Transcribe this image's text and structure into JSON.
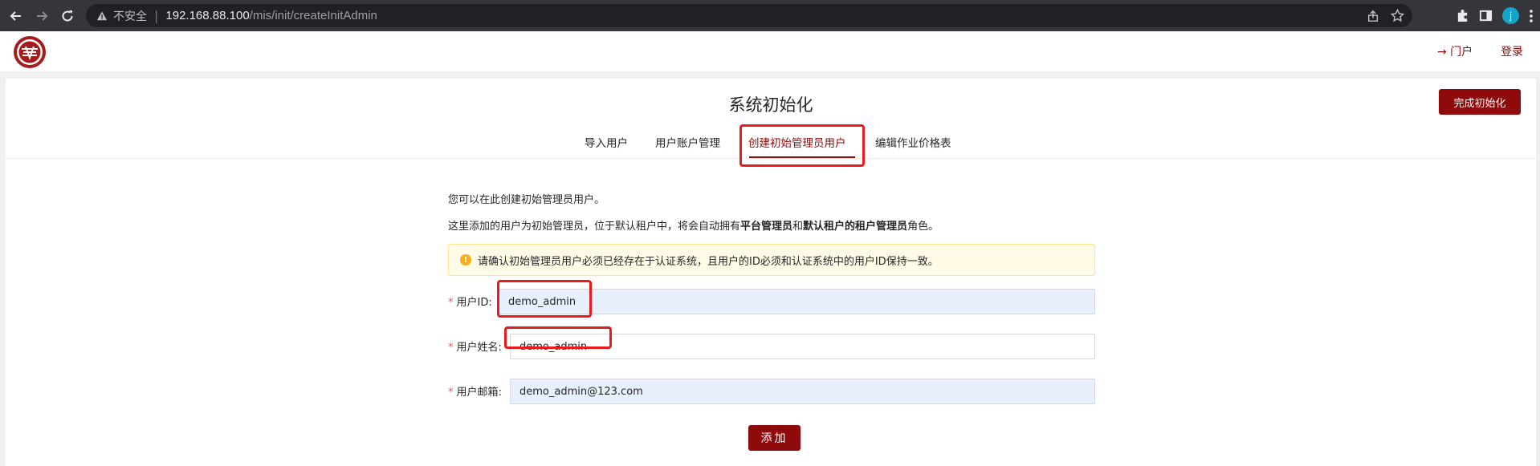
{
  "browser": {
    "insecure_label": "不安全",
    "url_host": "192.168.88.100",
    "url_path": "/mis/init/createInitAdmin",
    "profile_initial": "j"
  },
  "header": {
    "portal_link": "→ 门户",
    "login_link": "登录"
  },
  "page": {
    "title": "系统初始化",
    "finish_button": "完成初始化",
    "tabs": [
      {
        "label": "导入用户",
        "active": false
      },
      {
        "label": "用户账户管理",
        "active": false
      },
      {
        "label": "创建初始管理员用户",
        "active": true
      },
      {
        "label": "编辑作业价格表",
        "active": false
      }
    ],
    "intro": "您可以在此创建初始管理员用户。",
    "desc_prefix": "这里添加的用户为初始管理员，位于默认租户中，将会自动拥有",
    "desc_role1": "平台管理员",
    "desc_and": "和",
    "desc_role2": "默认租户的租户管理员",
    "desc_suffix": "角色。",
    "alert_text": "请确认初始管理员用户必须已经存在于认证系统，且用户的ID必须和认证系统中的用户ID保持一致。",
    "form": {
      "required_mark": "*",
      "user_id_label": "用户ID:",
      "user_id_value": "demo_admin",
      "user_name_label": "用户姓名:",
      "user_name_value": "demo_admin",
      "email_label": "用户邮箱:",
      "email_value": "demo_admin@123.com"
    },
    "add_button": "添加"
  },
  "colors": {
    "brand": "#8f0b0b",
    "highlight": "#e81c1c",
    "alert_bg": "#fffbe6",
    "autofill_bg": "#e8f0fe"
  }
}
